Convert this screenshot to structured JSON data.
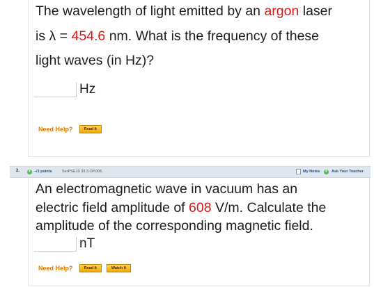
{
  "question1": {
    "text_line1_pre": "The wavelength of light emitted by an ",
    "text_line1_red": "argon",
    "text_line1_post": " laser",
    "text_line2_pre": "is λ = ",
    "text_line2_red": "454.6",
    "text_line2_post": " nm. What is the frequency of these",
    "text_line3": "light waves (in Hz)?",
    "answer_value": "",
    "unit": "Hz",
    "need_help_label": "Need Help?",
    "read_it_label": "Read It"
  },
  "question2": {
    "number": "2.",
    "points": "–/1 points",
    "source": "SerPSE10 33.3.OP.006.",
    "my_notes_label": "My Notes",
    "ask_teacher_label": "Ask Your Teacher",
    "text_line1": "An electromagnetic wave in vacuum has an",
    "text_line2_pre": "electric field amplitude of ",
    "text_line2_red": "608",
    "text_line2_post": " V/m. Calculate the",
    "text_line3": "amplitude of the corresponding magnetic field.",
    "answer_value": "",
    "unit": "nT",
    "need_help_label": "Need Help?",
    "read_it_label": "Read It",
    "watch_it_label": "Watch It"
  },
  "colors": {
    "highlight": "#d8191b",
    "need_help": "#e07b00",
    "button_bg": "#f2a900",
    "header_bar": "#dfe6ee",
    "link_blue": "#1b4f8a",
    "plus_green": "#57b957"
  }
}
